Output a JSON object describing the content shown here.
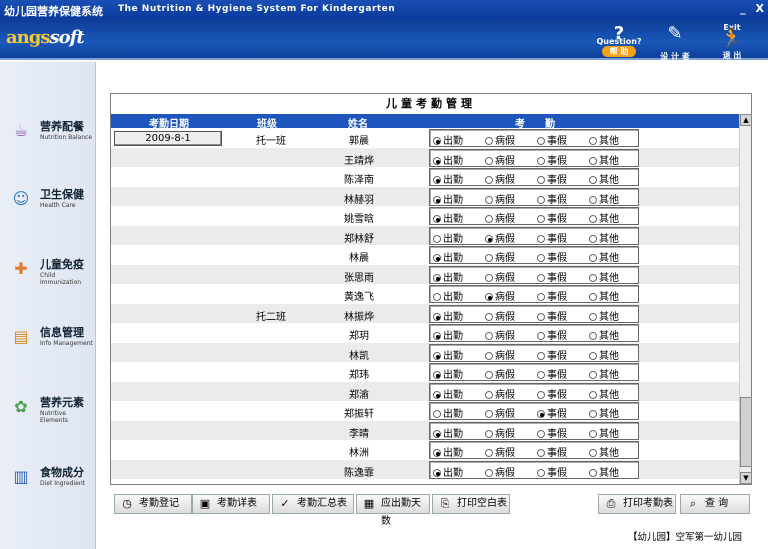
{
  "titlebar": {
    "cn": "幼儿园营养保健系统",
    "en": "The Nutrition & Hygiene System For Kindergarten",
    "min": "_",
    "close": "X"
  },
  "logo": {
    "a": "angs",
    "b": "soft"
  },
  "header": {
    "help_top": "Question?",
    "help": "帮 助",
    "designer": "设 计 者",
    "exit_top": "Exit",
    "exit": "退 出"
  },
  "sidebar": [
    {
      "cn": "营养配餐",
      "en": "Nutrition Balance",
      "icon": "bowl-icon",
      "color": "#8a5ab0"
    },
    {
      "cn": "卫生保健",
      "en": "Health  Care",
      "icon": "doctor-icon",
      "color": "#2a7bc4"
    },
    {
      "cn": "儿童免疫",
      "en": "Child Immunization",
      "icon": "syringe-icon",
      "color": "#e07b2a"
    },
    {
      "cn": "信息管理",
      "en": "Info Management",
      "icon": "chart-icon",
      "color": "#d98a1f"
    },
    {
      "cn": "营养元素",
      "en": "Nutritive Elements",
      "icon": "molecule-icon",
      "color": "#4aa050"
    },
    {
      "cn": "食物成分",
      "en": "Diet Ingredient",
      "icon": "book-icon",
      "color": "#2b64b8"
    }
  ],
  "panel": {
    "title": "儿童考勤管理"
  },
  "columns": {
    "date": "考勤日期",
    "class": "班级",
    "name": "姓名",
    "attend": "考　　勤"
  },
  "options": [
    "出勤",
    "病假",
    "事假",
    "其他"
  ],
  "rows": [
    {
      "date": "2009-8-1",
      "class": "托一班",
      "name": "郭晨",
      "sel": 0
    },
    {
      "date": "",
      "class": "",
      "name": "王靖烨",
      "sel": 0
    },
    {
      "date": "",
      "class": "",
      "name": "陈泽南",
      "sel": 0
    },
    {
      "date": "",
      "class": "",
      "name": "林赫羽",
      "sel": 0
    },
    {
      "date": "",
      "class": "",
      "name": "姚雪晗",
      "sel": 0
    },
    {
      "date": "",
      "class": "",
      "name": "郑林舒",
      "sel": 1
    },
    {
      "date": "",
      "class": "",
      "name": "林晨",
      "sel": 0
    },
    {
      "date": "",
      "class": "",
      "name": "张思雨",
      "sel": 0
    },
    {
      "date": "",
      "class": "",
      "name": "黄逸飞",
      "sel": 1
    },
    {
      "date": "",
      "class": "托二班",
      "name": "林振烨",
      "sel": 0
    },
    {
      "date": "",
      "class": "",
      "name": "郑玥",
      "sel": 0
    },
    {
      "date": "",
      "class": "",
      "name": "林凯",
      "sel": 0
    },
    {
      "date": "",
      "class": "",
      "name": "郑玮",
      "sel": 0
    },
    {
      "date": "",
      "class": "",
      "name": "郑渝",
      "sel": 0
    },
    {
      "date": "",
      "class": "",
      "name": "郑振轩",
      "sel": 2
    },
    {
      "date": "",
      "class": "",
      "name": "李晴",
      "sel": 0
    },
    {
      "date": "",
      "class": "",
      "name": "林洲",
      "sel": 0
    },
    {
      "date": "",
      "class": "",
      "name": "陈逸霏",
      "sel": 0
    }
  ],
  "toolbar": [
    {
      "label": "考勤登记",
      "icon": "clock-icon",
      "name": "attendance-register-button"
    },
    {
      "label": "考勤详表",
      "icon": "folder-icon",
      "name": "attendance-detail-button"
    },
    {
      "label": "考勤汇总表",
      "icon": "summary-icon",
      "name": "attendance-summary-button"
    },
    {
      "label": "应出勤天数",
      "icon": "calendar-icon",
      "name": "required-days-button"
    },
    {
      "label": "打印空白表",
      "icon": "blank-print-icon",
      "name": "print-blank-button"
    },
    {
      "label": "打印考勤表",
      "icon": "printer-icon",
      "name": "print-attendance-button"
    },
    {
      "label": "查  询",
      "icon": "search-icon",
      "name": "query-button"
    }
  ],
  "footer": "【幼儿园】空军第一幼儿园"
}
